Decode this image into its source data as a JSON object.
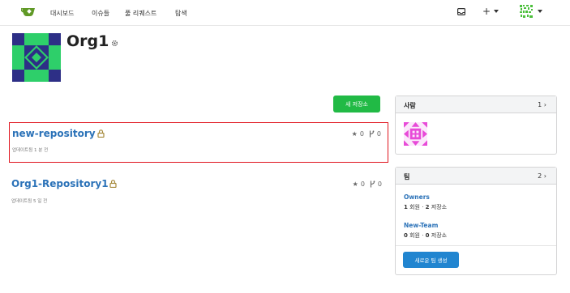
{
  "nav": {
    "items": [
      {
        "label": "대시보드"
      },
      {
        "label": "이슈들"
      },
      {
        "label": "풀 리퀘스트"
      },
      {
        "label": "탐색"
      }
    ],
    "plus_label": "+"
  },
  "org": {
    "name": "Org1"
  },
  "new_repo_button": "새 저장소",
  "repos": [
    {
      "name": "new-repository",
      "updated": "업데이트됨 1 분 전",
      "stars": "0",
      "forks": "0"
    },
    {
      "name": "Org1-Repository1",
      "updated": "업데이트됨 5 일 전",
      "stars": "0",
      "forks": "0"
    }
  ],
  "people": {
    "title": "사람",
    "count": "1 ›"
  },
  "teams": {
    "title": "팀",
    "count": "2 ›",
    "items": [
      {
        "name": "Owners",
        "members": "1",
        "members_label": " 회원 · ",
        "repos": "2",
        "repos_label": " 저장소"
      },
      {
        "name": "New-Team",
        "members": "0",
        "members_label": " 회원 · ",
        "repos": "0",
        "repos_label": " 저장소"
      }
    ],
    "new_team_button": "새로운 팀 생성"
  },
  "colors": {
    "accent_green": "#21ba45",
    "link_blue": "#2b72b8",
    "button_blue": "#2185d0",
    "highlight_red": "#e0141e"
  }
}
